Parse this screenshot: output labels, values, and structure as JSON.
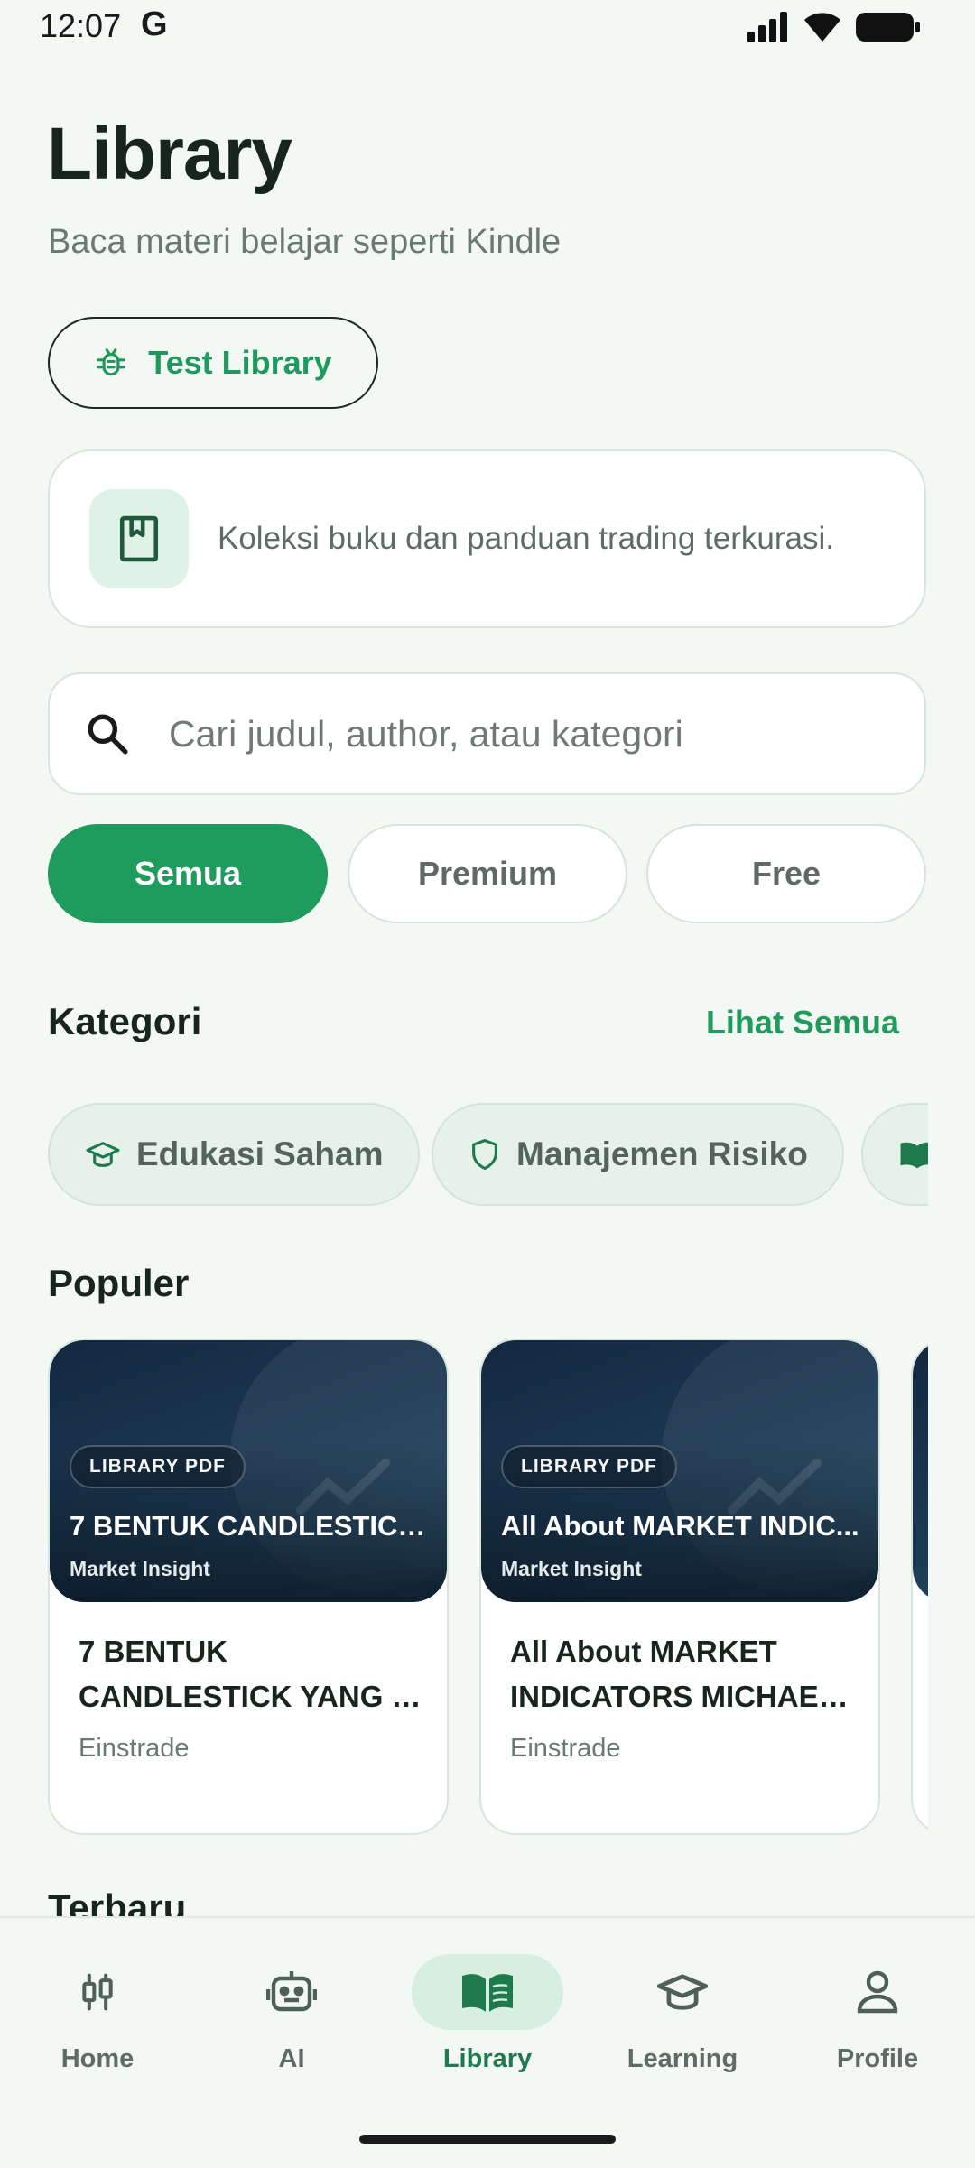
{
  "status_bar": {
    "time": "12:07",
    "google_glyph": "G",
    "icons": [
      "signal-icon",
      "wifi-icon",
      "battery-icon"
    ]
  },
  "header": {
    "title": "Library",
    "subtitle": "Baca materi belajar seperti Kindle"
  },
  "test_button": {
    "label": "Test Library",
    "icon": "bug-icon"
  },
  "info_card": {
    "icon": "book-bookmark-icon",
    "text": "Koleksi buku dan panduan trading terkurasi."
  },
  "search": {
    "placeholder": "Cari judul, author, atau kategori",
    "icon": "search-icon"
  },
  "filters": [
    {
      "label": "Semua",
      "active": true
    },
    {
      "label": "Premium",
      "active": false
    },
    {
      "label": "Free",
      "active": false
    }
  ],
  "categories_section": {
    "title": "Kategori",
    "see_all": "Lihat Semua",
    "items": [
      {
        "label": "Edukasi Saham",
        "icon": "graduation-cap-icon"
      },
      {
        "label": "Manajemen Risiko",
        "icon": "shield-icon"
      },
      {
        "label": "",
        "icon": "open-book-icon"
      }
    ]
  },
  "popular_section": {
    "title": "Populer",
    "books": [
      {
        "badge": "LIBRARY PDF",
        "cover_title": "7 BENTUK CANDLESTICK...",
        "cover_subtitle": "Market Insight",
        "title": "7 BENTUK CANDLESTICK YANG …",
        "author": "Einstrade"
      },
      {
        "badge": "LIBRARY PDF",
        "cover_title": "All About MARKET INDIC...",
        "cover_subtitle": "Market Insight",
        "title": "All About MARKET INDICATORS MICHAE…",
        "author": "Einstrade"
      }
    ]
  },
  "newest_section": {
    "title": "Terbaru"
  },
  "bottom_nav": [
    {
      "label": "Home",
      "icon": "chart-candles-icon",
      "active": false
    },
    {
      "label": "AI",
      "icon": "robot-icon",
      "active": false
    },
    {
      "label": "Library",
      "icon": "open-book-icon",
      "active": true
    },
    {
      "label": "Learning",
      "icon": "graduation-cap-icon",
      "active": false
    },
    {
      "label": "Profile",
      "icon": "person-icon",
      "active": false
    }
  ],
  "colors": {
    "background": "#f3f8f5",
    "accent": "#1f9c5d",
    "cover_dark": "#142740"
  }
}
